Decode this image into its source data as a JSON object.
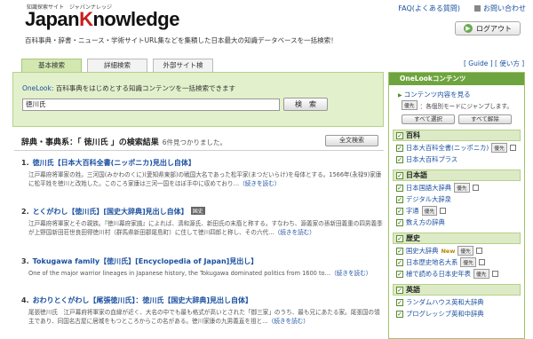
{
  "header": {
    "logo_small": "知識探索サイト　ジャパンナレッジ",
    "logo_pre": "Japan",
    "logo_k": "K",
    "logo_post": "nowledge",
    "tagline": "百科事典・辞書・ニュース・学術サイトURL集などを集積した日本最大の知識データベースを一括検索！",
    "faq": "FAQ(よくある質問)",
    "contact": "お問い合わせ",
    "logout": "ログアウト"
  },
  "tabs": [
    {
      "label": "基本検索",
      "active": true
    },
    {
      "label": "詳細検索",
      "active": false
    },
    {
      "label": "外部サイト検索",
      "active": false
    }
  ],
  "guide_links": "[ Guide ]  [ 使い方 ]",
  "search": {
    "desc_onelook": "OneLook:",
    "desc_text": " 百科事典をはじめとする知識コンテンツを一括検索できます",
    "value": "徳川氏",
    "button": "検　索"
  },
  "results_header": {
    "title": "辞典・事典系：「 徳川氏 」の検索結果",
    "count": "6件見つかりました。",
    "all_button": "全文検索"
  },
  "results": [
    {
      "num": "1.",
      "title": "徳川氏【日本大百科全書(ニッポニカ)見出し自体】",
      "badge": "",
      "snippet": "江戸幕府将軍家の姓。三河国(みかわのくに)(愛知県東部)の戦国大名であった松平家(まつだいらけ)を母体とする。1566年(永禄9)家康に松平姓を徳川と改姓した。このころ家康は三河一国をほぼ手中に収めており…",
      "more": "（続きを読む）"
    },
    {
      "num": "2.",
      "title": "とくがわし【徳川氏】[国史大辞典]見出し自体】",
      "badge": "国史",
      "snippet": "江戸幕府将軍家とその親族。『徳川幕府家譜』によれば、清和源氏、新田氏の末裔と称する。すなわち、源義家の孫新田義重の四男義季が上野国新田荘世良田得徳川村（群馬県新田郡尾島町）に住して徳川四郎と称し、その六代…",
      "more": "（続きを読む）"
    },
    {
      "num": "3.",
      "title": "Tokugawa family【徳川氏】[Encyclopedia of Japan]見出し】",
      "badge": "",
      "snippet": "One of the major warrior lineages in Japanese history, the Tokugawa dominated politics from 1600 to…",
      "more": "（続きを読む）"
    },
    {
      "num": "4.",
      "title": "おわりとくがわし【尾張徳川氏】：徳川氏【国史大辞典]見出し自体】",
      "badge": "",
      "snippet": "尾張徳川氏　江戸幕府将軍家の血縁が近く、大名の中でも最も格式が高いとされた「御三家」のうち、最も兄にあたる家。尾張国の領主であり、同国名古屋に居城をもつところからこの名がある。徳川家康の九男義直を祖と…",
      "more": "（続きを読む）"
    }
  ],
  "sidebar": {
    "title": "OneLookコンテンツ",
    "link": "コンテンツ内容を見る",
    "note_tag": "優先",
    "note_text": "：各個別モードにジャンプします。",
    "select_all": "すべて選択",
    "deselect_all": "すべて解除",
    "categories": [
      {
        "name": "百科",
        "items": [
          {
            "label": "日本大百科全書(ニッポニカ)",
            "tag": "優先"
          },
          {
            "label": "日本大百科プラス",
            "tag": ""
          }
        ]
      },
      {
        "name": "日本語",
        "items": [
          {
            "label": "日本国語大辞典",
            "tag": "優先"
          },
          {
            "label": "デジタル大辞泉",
            "tag": ""
          },
          {
            "label": "字通",
            "tag": "優先"
          },
          {
            "label": "数え方の辞典",
            "tag": ""
          }
        ]
      },
      {
        "name": "歴史",
        "items": [
          {
            "label": "国史大辞典",
            "tag": "優先",
            "new": "New"
          },
          {
            "label": "日本歴史地名大系",
            "tag": "優先"
          },
          {
            "label": "檜で読める日本史年表",
            "tag": "優先"
          }
        ]
      },
      {
        "name": "英語",
        "items": [
          {
            "label": "ランダムハウス英和大辞典",
            "tag": ""
          },
          {
            "label": "プログレッシブ英和中辞典",
            "tag": ""
          }
        ]
      }
    ]
  }
}
